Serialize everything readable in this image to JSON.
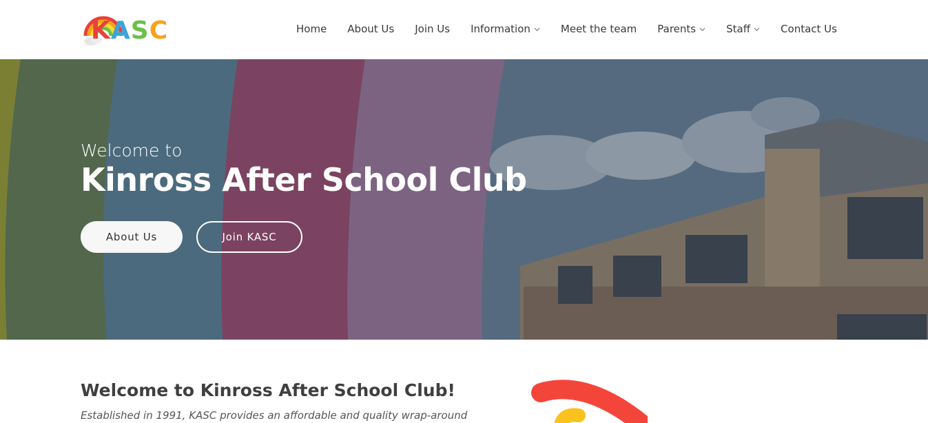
{
  "logo": {
    "text_letters": [
      "K",
      "A",
      "S",
      "C"
    ],
    "colors": [
      "#e8413b",
      "#3aa5d9",
      "#6cc04a",
      "#f7a21b"
    ]
  },
  "nav": {
    "items": [
      {
        "label": "Home",
        "has_dropdown": false
      },
      {
        "label": "About Us",
        "has_dropdown": false
      },
      {
        "label": "Join Us",
        "has_dropdown": false
      },
      {
        "label": "Information",
        "has_dropdown": true
      },
      {
        "label": "Meet the team",
        "has_dropdown": false
      },
      {
        "label": "Parents",
        "has_dropdown": true
      },
      {
        "label": "Staff",
        "has_dropdown": true
      },
      {
        "label": "Contact Us",
        "has_dropdown": false
      }
    ]
  },
  "hero": {
    "subtitle": "Welcome to",
    "title": "Kinross After School Club",
    "buttons": {
      "primary": "About Us",
      "secondary": "Join KASC"
    },
    "rainbow_colors": [
      "#8e9233",
      "#5c7550",
      "#55788c",
      "#8e4869",
      "#8f6f92"
    ]
  },
  "welcome": {
    "heading": "Welcome to Kinross After School Club!",
    "text": "Established in 1991, KASC provides an affordable and quality wrap-around"
  }
}
